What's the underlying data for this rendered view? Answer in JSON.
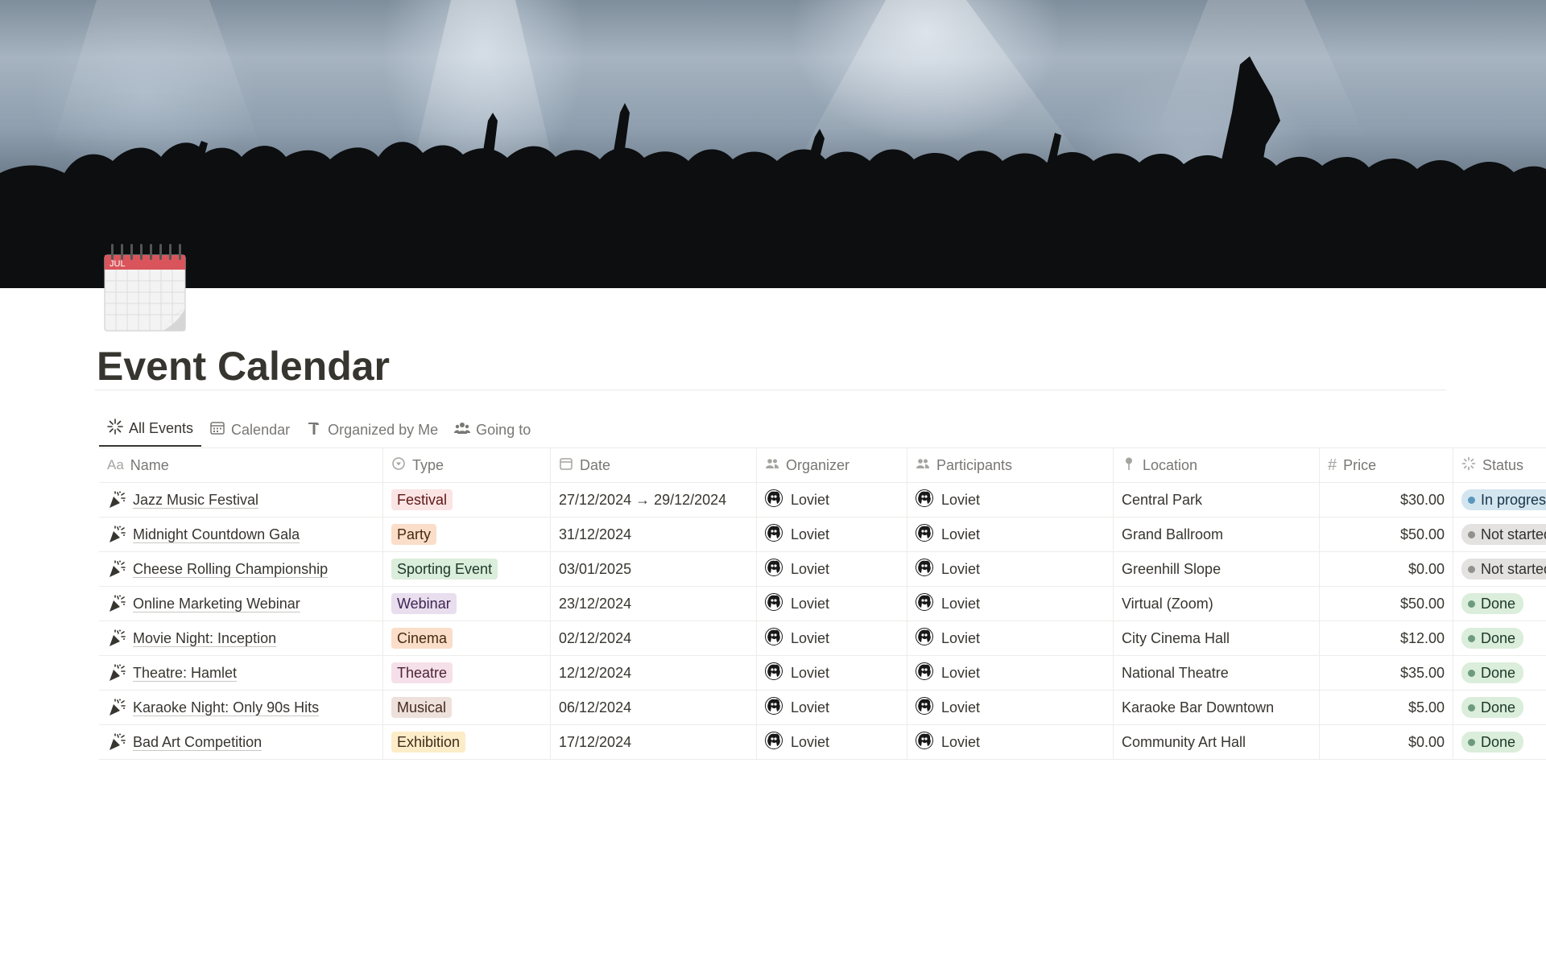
{
  "page": {
    "title": "Event Calendar",
    "icon": "spiral-calendar-icon",
    "icon_month": "JUL",
    "cover": "concert-crowd-cover-image"
  },
  "tabs": [
    {
      "label": "All Events",
      "icon": "sparkle-icon",
      "active": true
    },
    {
      "label": "Calendar",
      "icon": "calendar-icon",
      "active": false
    },
    {
      "label": "Organized by Me",
      "icon": "hammer-icon",
      "active": false
    },
    {
      "label": "Going to",
      "icon": "people-icon",
      "active": false
    }
  ],
  "columns": {
    "name": "Name",
    "name_prefix": "Aa",
    "type": "Type",
    "date": "Date",
    "organizer": "Organizer",
    "participants": "Participants",
    "location": "Location",
    "price": "Price",
    "status": "Status"
  },
  "type_colors": {
    "Festival": {
      "bg": "#fbe4e4",
      "fg": "#5d1715"
    },
    "Party": {
      "bg": "#fadec9",
      "fg": "#49290e"
    },
    "Sporting Event": {
      "bg": "#dbeddb",
      "fg": "#1c3829"
    },
    "Webinar": {
      "bg": "#e8deee",
      "fg": "#412454"
    },
    "Cinema": {
      "bg": "#fadec9",
      "fg": "#49290e"
    },
    "Theatre": {
      "bg": "#f5e0e9",
      "fg": "#4c2337"
    },
    "Musical": {
      "bg": "#eee0da",
      "fg": "#442a1e"
    },
    "Exhibition": {
      "bg": "#fdecc8",
      "fg": "#402c1b"
    }
  },
  "status_colors": {
    "In progress": {
      "bg": "#d3e5ef",
      "fg": "#183347",
      "dot": "#5b97bd"
    },
    "Not started": {
      "bg": "#e3e2e0",
      "fg": "#32302c",
      "dot": "#91918e"
    },
    "Done": {
      "bg": "#dbeddb",
      "fg": "#1c3829",
      "dot": "#6c9b7d"
    }
  },
  "rows": [
    {
      "name": "Jazz Music Festival",
      "type": "Festival",
      "date": "27/12/2024 → 29/12/2024",
      "organizer": "Loviet",
      "participants": "Loviet",
      "location": "Central Park",
      "price": "$30.00",
      "status": "In progress"
    },
    {
      "name": "Midnight Countdown Gala",
      "type": "Party",
      "date": "31/12/2024",
      "organizer": "Loviet",
      "participants": "Loviet",
      "location": "Grand Ballroom",
      "price": "$50.00",
      "status": "Not started"
    },
    {
      "name": "Cheese Rolling Championship",
      "type": "Sporting Event",
      "date": "03/01/2025",
      "organizer": "Loviet",
      "participants": "Loviet",
      "location": "Greenhill Slope",
      "price": "$0.00",
      "status": "Not started"
    },
    {
      "name": "Online Marketing Webinar",
      "type": "Webinar",
      "date": "23/12/2024",
      "organizer": "Loviet",
      "participants": "Loviet",
      "location": "Virtual (Zoom)",
      "price": "$50.00",
      "status": "Done"
    },
    {
      "name": "Movie Night: Inception",
      "type": "Cinema",
      "date": "02/12/2024",
      "organizer": "Loviet",
      "participants": "Loviet",
      "location": "City Cinema Hall",
      "price": "$12.00",
      "status": "Done"
    },
    {
      "name": "Theatre: Hamlet",
      "type": "Theatre",
      "date": "12/12/2024",
      "organizer": "Loviet",
      "participants": "Loviet",
      "location": "National Theatre",
      "price": "$35.00",
      "status": "Done"
    },
    {
      "name": "Karaoke Night: Only 90s Hits",
      "type": "Musical",
      "date": "06/12/2024",
      "organizer": "Loviet",
      "participants": "Loviet",
      "location": "Karaoke Bar Downtown",
      "price": "$5.00",
      "status": "Done"
    },
    {
      "name": "Bad Art Competition",
      "type": "Exhibition",
      "date": "17/12/2024",
      "organizer": "Loviet",
      "participants": "Loviet",
      "location": "Community Art Hall",
      "price": "$0.00",
      "status": "Done"
    }
  ]
}
